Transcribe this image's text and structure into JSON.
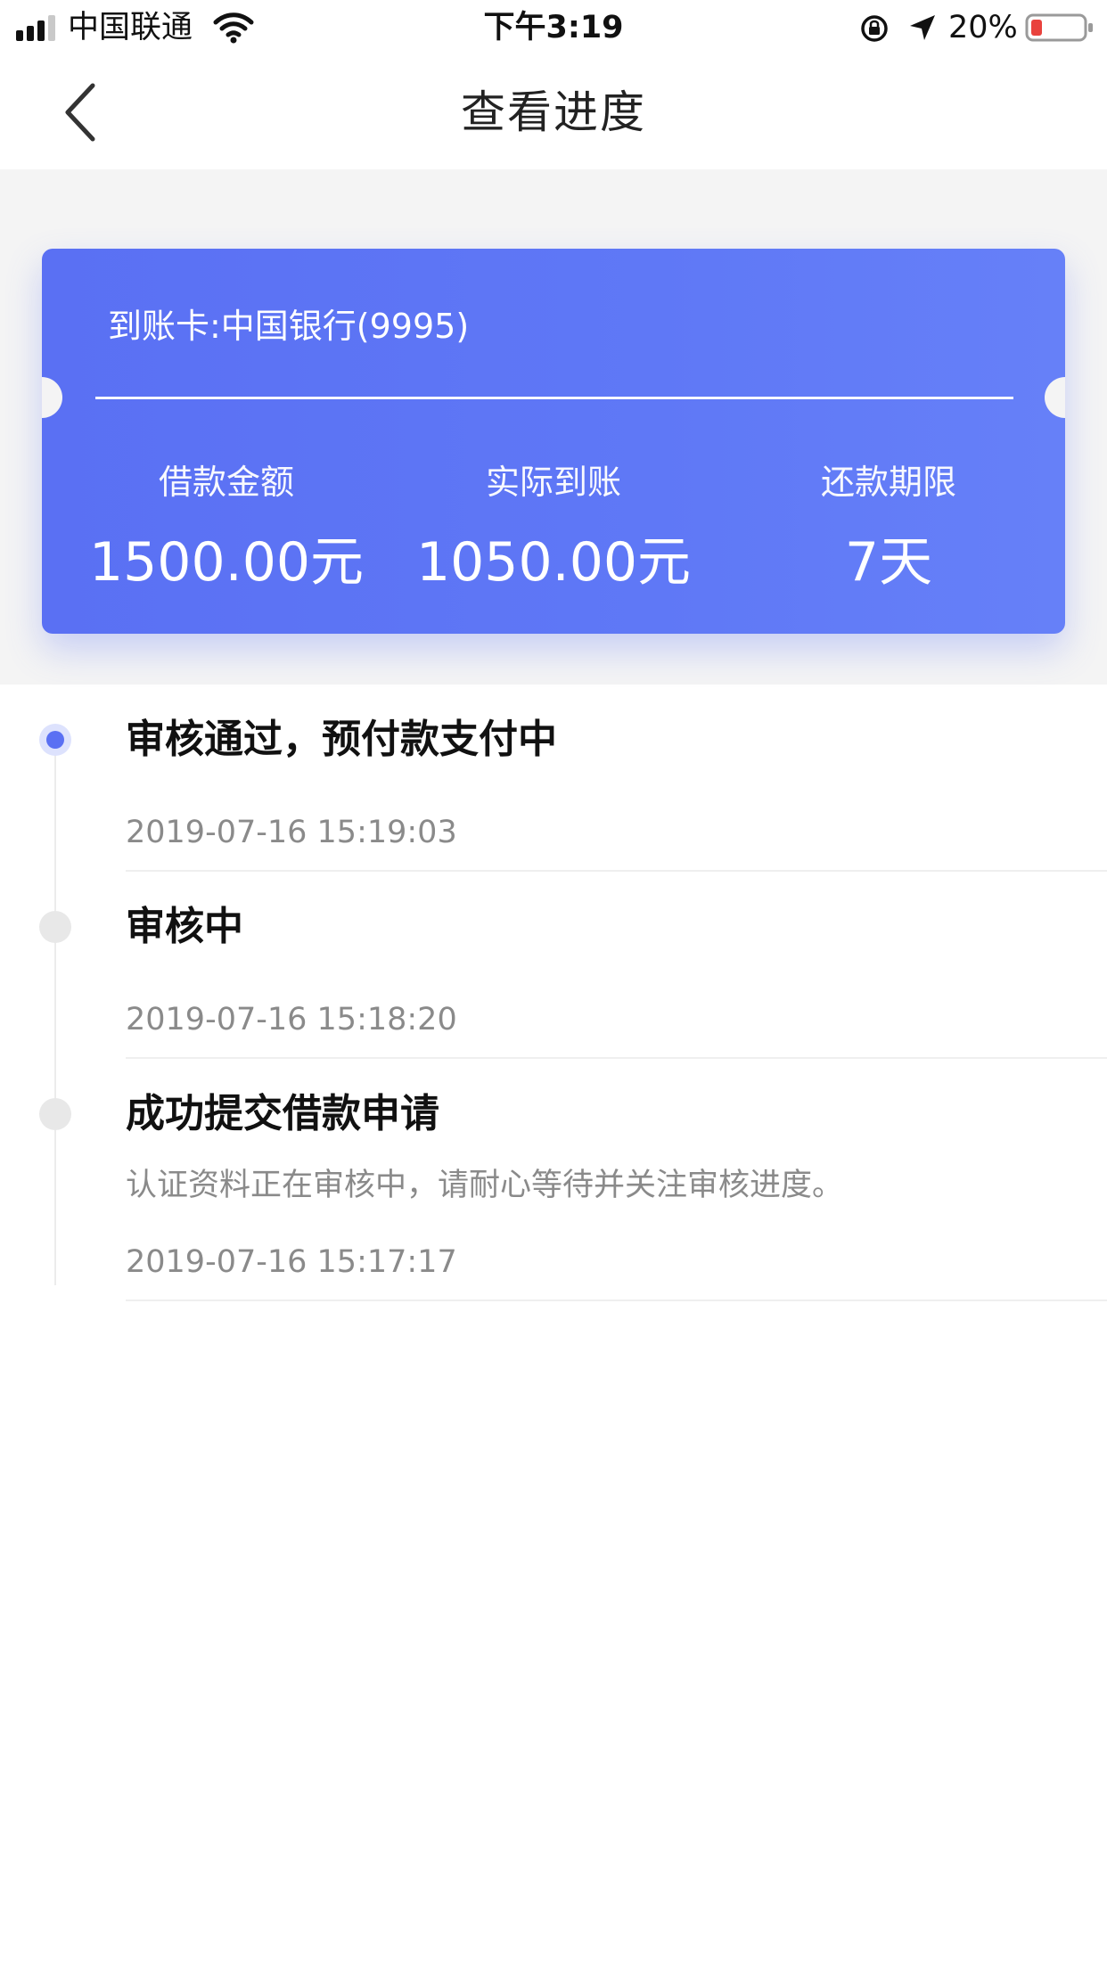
{
  "status_bar": {
    "carrier": "中国联通",
    "time": "下午3:19",
    "battery_percent": "20%"
  },
  "nav": {
    "title": "查看进度"
  },
  "summary": {
    "card_label": "到账卡:中国银行(9995)",
    "metrics": [
      {
        "label": "借款金额",
        "value": "1500.00元"
      },
      {
        "label": "实际到账",
        "value": "1050.00元"
      },
      {
        "label": "还款期限",
        "value": "7天"
      }
    ]
  },
  "timeline": {
    "steps": [
      {
        "title": "审核通过，预付款支付中",
        "description": "",
        "time": "2019-07-16 15:19:03",
        "active": true
      },
      {
        "title": "审核中",
        "description": "",
        "time": "2019-07-16 15:18:20",
        "active": false
      },
      {
        "title": "成功提交借款申请",
        "description": "认证资料正在审核中，请耐心等待并关注审核进度。",
        "time": "2019-07-16 15:17:17",
        "active": false
      }
    ]
  },
  "colors": {
    "accent": "#5a70f3",
    "card_gradient_start": "#5a70f3",
    "card_gradient_end": "#6680f8",
    "timeline_inactive": "#e8e8e8",
    "secondary_text": "#8a8a8a"
  },
  "icons": {
    "back": "chevron-left-icon",
    "signal": "signal-icon",
    "wifi": "wifi-icon",
    "lock": "rotation-lock-icon",
    "location": "location-arrow-icon",
    "battery": "battery-icon"
  }
}
